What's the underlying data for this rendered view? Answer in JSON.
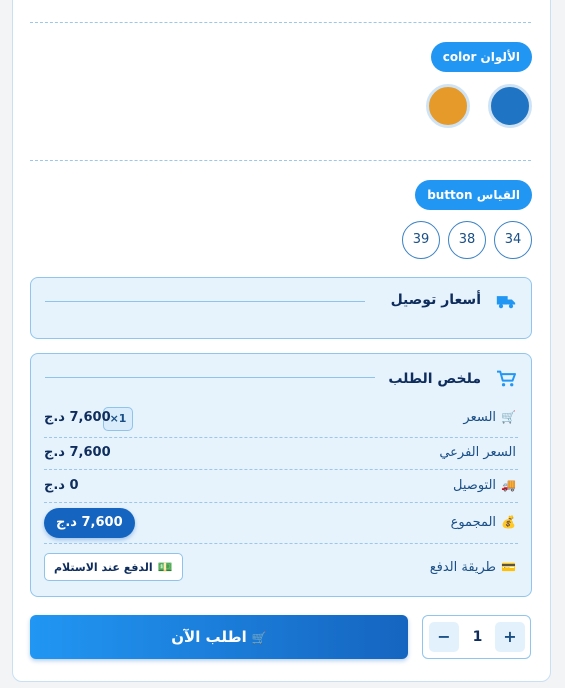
{
  "colors_section": {
    "label": "الألوان color",
    "swatches": [
      {
        "name": "blue",
        "hex": "#1f74c4"
      },
      {
        "name": "orange",
        "hex": "#e59a2a"
      }
    ]
  },
  "size_section": {
    "label": "القياس button",
    "options": [
      "34",
      "38",
      "39"
    ]
  },
  "delivery_box": {
    "title": "أسعار توصيل",
    "icon": "truck-icon"
  },
  "summary_box": {
    "title": "ملخص الطلب",
    "icon": "cart-icon",
    "rows": {
      "price": {
        "icon": "🛒",
        "label": "السعر",
        "value": "7,600 د.ج",
        "qty": "×1"
      },
      "subtotal": {
        "label": "السعر الفرعي",
        "value": "7,600 د.ج"
      },
      "delivery": {
        "icon": "🚚",
        "label": "التوصيل",
        "value": "0 د.ج"
      },
      "total": {
        "icon": "💰",
        "label": "المجموع",
        "value": "7,600 د.ج"
      },
      "payment": {
        "icon": "💳",
        "label": "طريقة الدفع",
        "badge_icon": "💵",
        "value": "الدفع عند الاستلام"
      }
    }
  },
  "order": {
    "button_label": "اطلب الآن",
    "button_icon": "🛒",
    "quantity": "1",
    "plus": "+",
    "minus": "−"
  },
  "theme": {
    "accent": "#2196f3",
    "accent_dark": "#1565c0"
  }
}
